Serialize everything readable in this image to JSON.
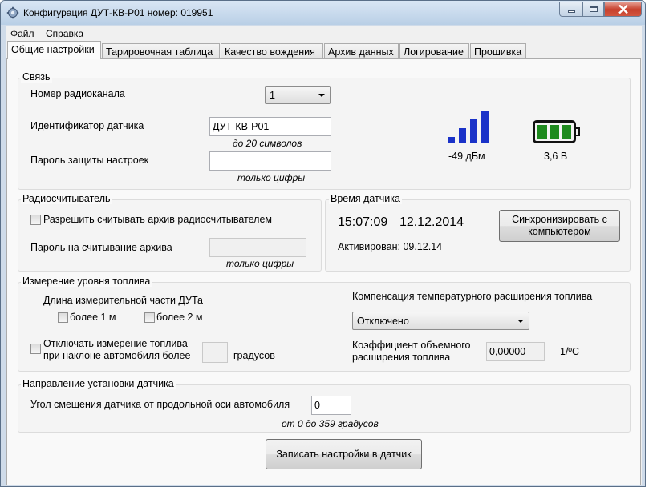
{
  "window": {
    "title": "Конфигурация ДУТ-КВ-Р01 номер: 019951",
    "minimize": "minimize",
    "maximize": "maximize",
    "close": "close"
  },
  "menu": {
    "file": "Файл",
    "help": "Справка"
  },
  "tabs": [
    {
      "label": "Общие настройки",
      "active": true
    },
    {
      "label": "Тарировочная таблица",
      "active": false
    },
    {
      "label": "Качество вождения",
      "active": false
    },
    {
      "label": "Архив данных",
      "active": false
    },
    {
      "label": "Логирование",
      "active": false
    },
    {
      "label": "Прошивка",
      "active": false
    }
  ],
  "connection": {
    "title": "Связь",
    "radio_channel_label": "Номер радиоканала",
    "radio_channel_value": "1",
    "sensor_id_label": "Идентификатор датчика",
    "sensor_id_value": "ДУТ-КВ-Р01",
    "sensor_id_hint": "до 20 символов",
    "password_label": "Пароль защиты настроек",
    "password_value": "",
    "password_hint": "только цифры",
    "signal_text": "-49 дБм",
    "signal_bars_active": 4,
    "battery_text": "3,6 В",
    "battery_cells": 3
  },
  "radio_reader": {
    "title": "Радиосчитыватель",
    "allow_label": "Разрешить считывать архив радиосчитывателем",
    "allow_checked": false,
    "archive_password_label": "Пароль на считывание архива",
    "archive_password_value": "",
    "archive_password_hint": "только цифры"
  },
  "sensor_time": {
    "title": "Время датчика",
    "time": "15:07:09",
    "date": "12.12.2014",
    "sync_button": "Синхронизировать с компьютером",
    "activated": "Активирован: 09.12.14"
  },
  "fuel_measure": {
    "title": "Измерение уровня топлива",
    "length_label": "Длина измерительной части ДУТа",
    "more_1m": "более 1 м",
    "more_1m_checked": false,
    "more_2m": "более 2 м",
    "more_2m_checked": false,
    "tilt_label_1": "Отключать измерение топлива",
    "tilt_label_2": "при наклоне автомобиля более",
    "tilt_checked": false,
    "tilt_value": "",
    "tilt_unit": "градусов",
    "compensation_label": "Компенсация температурного расширения топлива",
    "compensation_value": "Отключено",
    "coef_label_1": "Коэффициент объемного",
    "coef_label_2": "расширения топлива",
    "coef_value": "0,00000",
    "coef_unit": "1/ºC"
  },
  "direction": {
    "title": "Направление установки датчика",
    "angle_label": "Угол смещения датчика от продольной оси автомобиля",
    "angle_value": "0",
    "angle_hint": "от 0 до 359 градусов"
  },
  "write_button": "Записать настройки в датчик",
  "icons": {
    "app": "gear-icon",
    "signal": "signal-strength-icon",
    "battery": "battery-icon"
  },
  "colors": {
    "signal": "#1a32c8",
    "battery_cells": "#1e8a1e"
  }
}
